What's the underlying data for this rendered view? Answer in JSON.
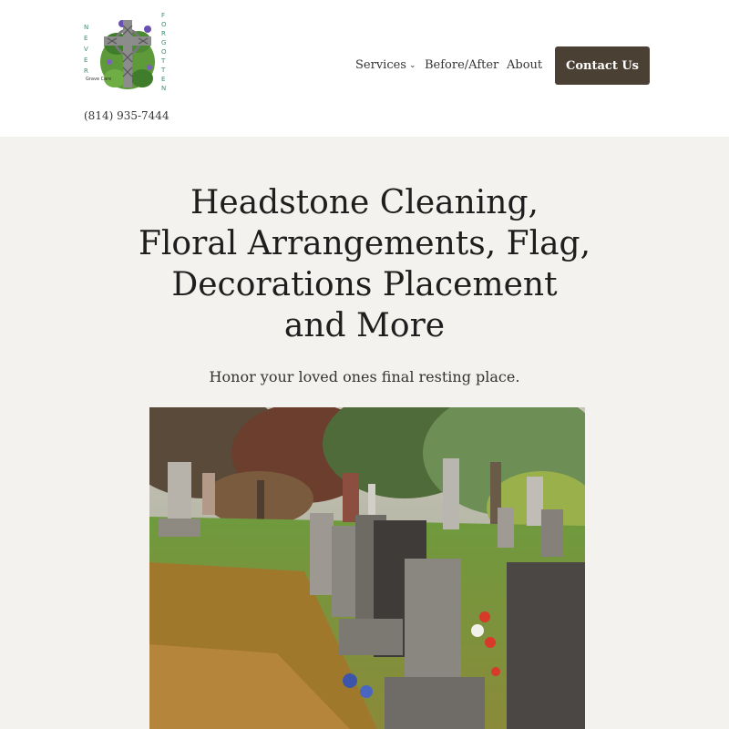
{
  "header": {
    "logo": {
      "vertical_left": "NEVER",
      "vertical_right": "FORGOTTEN",
      "caption": "Grave Care",
      "icon": "celtic-cross-icon"
    },
    "phone": "(814) 935-7444",
    "nav": {
      "services": "Services",
      "services_icon": "chevron-down-icon",
      "before_after": "Before/After",
      "about": "About"
    },
    "contact_button": "Contact Us"
  },
  "hero": {
    "title": "Headstone Cleaning, Floral Arrangements, Flag, Decorations Placement and More",
    "subtitle": "Honor your loved ones final resting place."
  },
  "colors": {
    "button_bg": "#4b4034",
    "hero_bg": "#f4f2ee",
    "logo_letters": "#3a8f6e"
  }
}
